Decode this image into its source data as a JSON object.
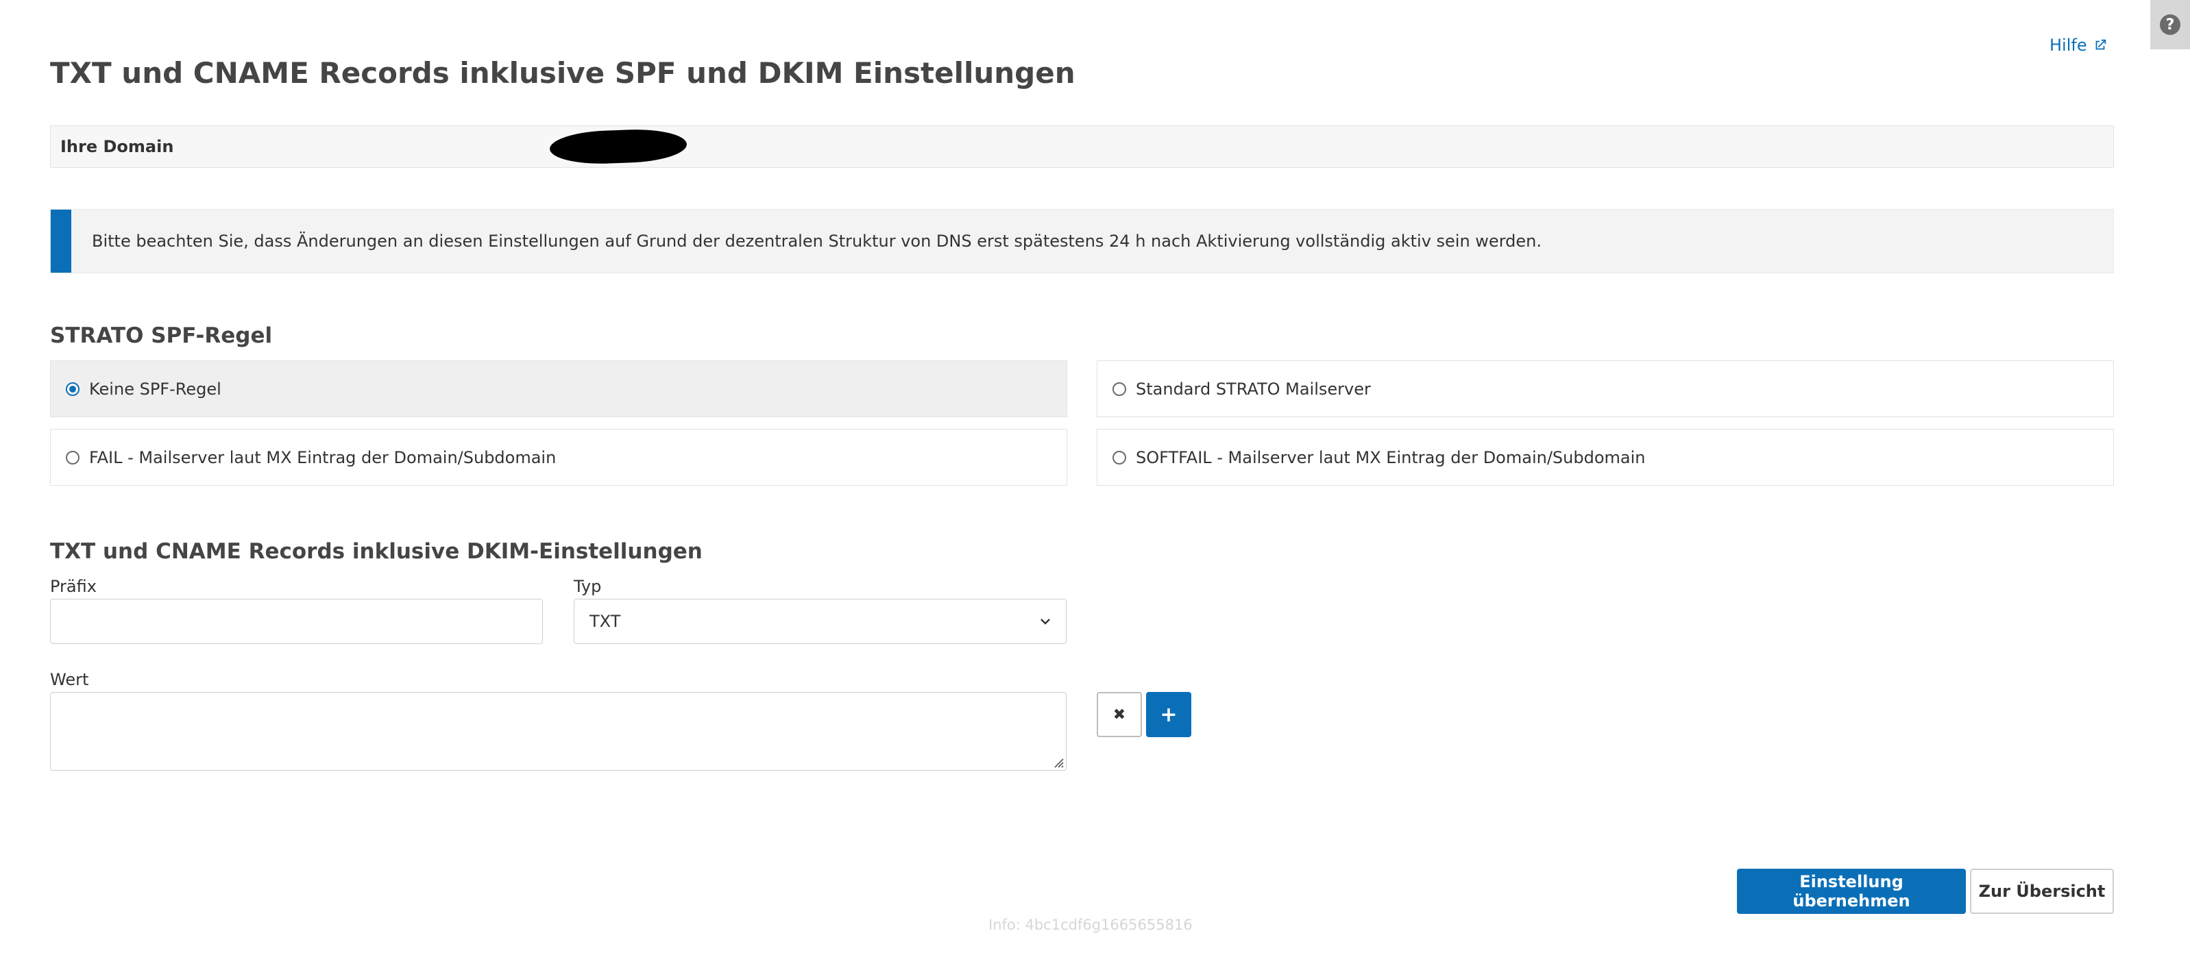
{
  "help_corner": {
    "icon": "question-circle-icon",
    "glyph": "?"
  },
  "header": {
    "help_label": "Hilfe",
    "help_icon": "external-link-icon",
    "title": "TXT und CNAME Records inklusive SPF und DKIM Einstellungen"
  },
  "domain": {
    "label": "Ihre Domain",
    "value_redacted": true
  },
  "notice": {
    "text": "Bitte beachten Sie, dass Änderungen an diesen Einstellungen auf Grund der dezentralen Struktur von DNS erst spätestens 24 h nach Aktivierung vollständig aktiv sein werden."
  },
  "spf": {
    "title": "STRATO SPF-Regel",
    "options": [
      {
        "label": "Keine SPF-Regel",
        "selected": true
      },
      {
        "label": "Standard STRATO Mailserver",
        "selected": false
      },
      {
        "label": "FAIL - Mailserver laut MX Eintrag der Domain/Subdomain",
        "selected": false
      },
      {
        "label": "SOFTFAIL - Mailserver laut MX Eintrag der Domain/Subdomain",
        "selected": false
      }
    ]
  },
  "records": {
    "title": "TXT und CNAME Records inklusive DKIM-Einstellungen",
    "prefix_label": "Präfix",
    "prefix_value": "",
    "type_label": "Typ",
    "type_value": "TXT",
    "value_label": "Wert",
    "value_value": "",
    "remove_glyph": "✖",
    "add_glyph": "+"
  },
  "actions": {
    "apply_label": "Einstellung übernehmen",
    "overview_label": "Zur Übersicht"
  },
  "footer": {
    "info": "Info: 4bc1cdf6g1665655816"
  },
  "colors": {
    "accent": "#0b6fb8",
    "title_text": "#454545",
    "panel_bg": "#f3f3f3"
  }
}
